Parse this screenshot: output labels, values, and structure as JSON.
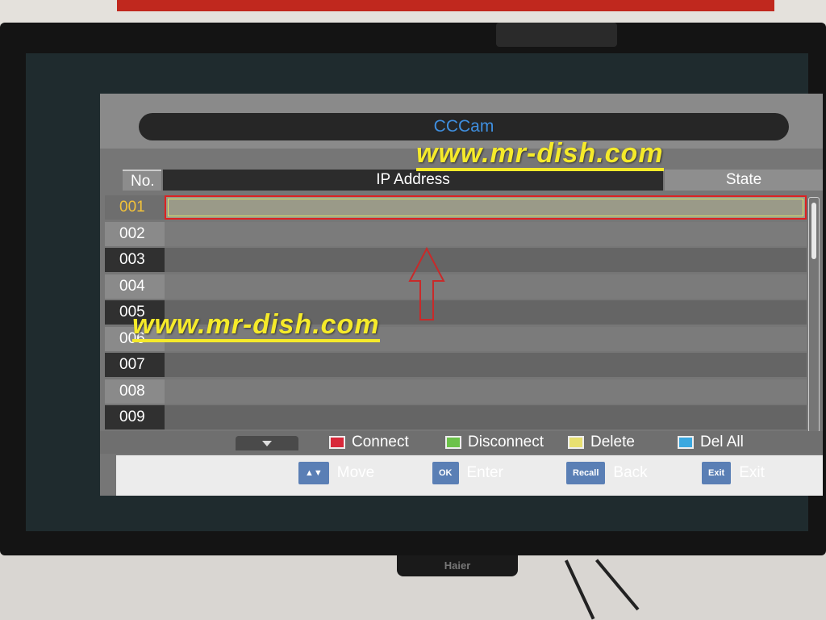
{
  "tv": {
    "brand": "Haier"
  },
  "osd": {
    "title": "CCCam",
    "columns": {
      "no": "No.",
      "ip": "IP Address",
      "state": "State"
    },
    "rows": [
      {
        "no": "001",
        "ip": "",
        "state": "",
        "selected": true
      },
      {
        "no": "002",
        "ip": "",
        "state": ""
      },
      {
        "no": "003",
        "ip": "",
        "state": ""
      },
      {
        "no": "004",
        "ip": "",
        "state": ""
      },
      {
        "no": "005",
        "ip": "",
        "state": ""
      },
      {
        "no": "006",
        "ip": "",
        "state": ""
      },
      {
        "no": "007",
        "ip": "",
        "state": ""
      },
      {
        "no": "008",
        "ip": "",
        "state": ""
      },
      {
        "no": "009",
        "ip": "",
        "state": ""
      }
    ],
    "color_keys": [
      {
        "label": "Connect",
        "color": "#d8283a"
      },
      {
        "label": "Disconnect",
        "color": "#6cc24a"
      },
      {
        "label": "Delete",
        "color": "#e8e070"
      },
      {
        "label": "Del All",
        "color": "#3aa8e0"
      }
    ],
    "nav_keys": [
      {
        "badge": "▲▼",
        "label": "Move"
      },
      {
        "badge": "OK",
        "label": "Enter"
      },
      {
        "badge": "Recall",
        "label": "Back"
      },
      {
        "badge": "Exit",
        "label": "Exit"
      }
    ]
  },
  "watermark": {
    "text": "www.mr-dish.com"
  }
}
